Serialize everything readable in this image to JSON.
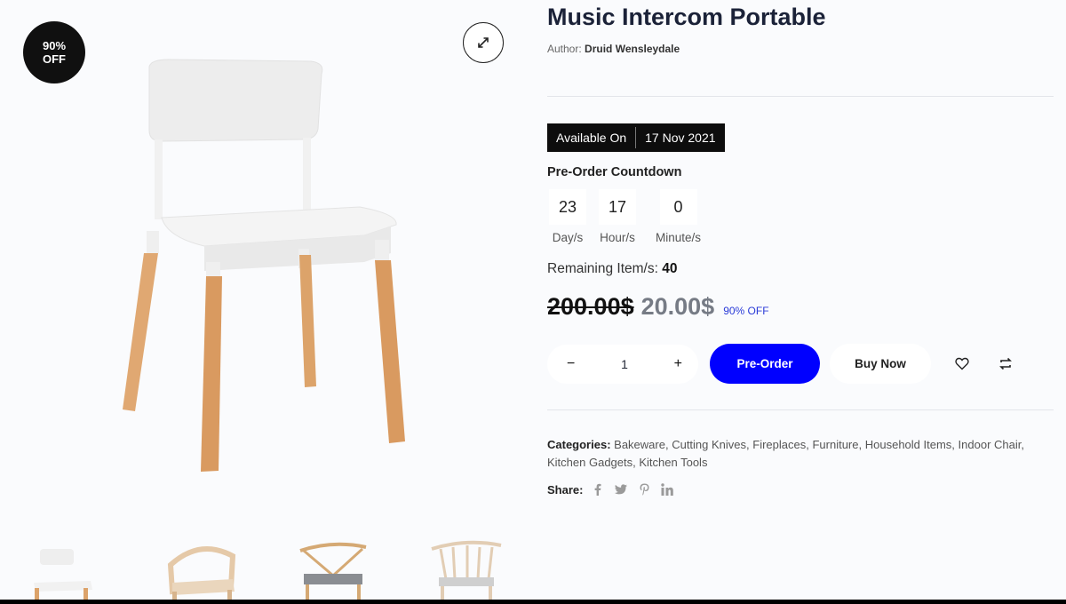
{
  "badge": {
    "line1": "90%",
    "line2": "OFF"
  },
  "product": {
    "title": "Music Intercom Portable",
    "author_label": "Author:",
    "author_name": "Druid Wensleydale"
  },
  "availability": {
    "label": "Available On",
    "date": "17 Nov 2021"
  },
  "countdown": {
    "title": "Pre-Order Countdown",
    "units": [
      {
        "value": "23",
        "label": "Day/s"
      },
      {
        "value": "17",
        "label": "Hour/s"
      },
      {
        "value": "0",
        "label": "Minute/s"
      }
    ]
  },
  "remaining": {
    "label": "Remaining Item/s:",
    "value": "40"
  },
  "price": {
    "old": "200.00$",
    "new": "20.00$",
    "off": "90% OFF"
  },
  "quantity": {
    "minus": "−",
    "value": "1",
    "plus": "+"
  },
  "actions": {
    "preorder": "Pre-Order",
    "buynow": "Buy Now"
  },
  "categories": {
    "label": "Categories:",
    "items": [
      "Bakeware",
      "Cutting Knives",
      "Fireplaces",
      "Furniture",
      "Household Items",
      "Indoor Chair",
      "Kitchen Gadgets",
      "Kitchen Tools"
    ]
  },
  "share": {
    "label": "Share:",
    "networks": [
      "facebook-icon",
      "twitter-icon",
      "pinterest-icon",
      "linkedin-icon"
    ]
  },
  "icons": {
    "zoom": "expand-icon",
    "wishlist": "heart-icon",
    "compare": "compare-icon"
  },
  "colors": {
    "accent": "#0000ff",
    "badge": "#101010",
    "discount_text": "#2a3bd8"
  }
}
